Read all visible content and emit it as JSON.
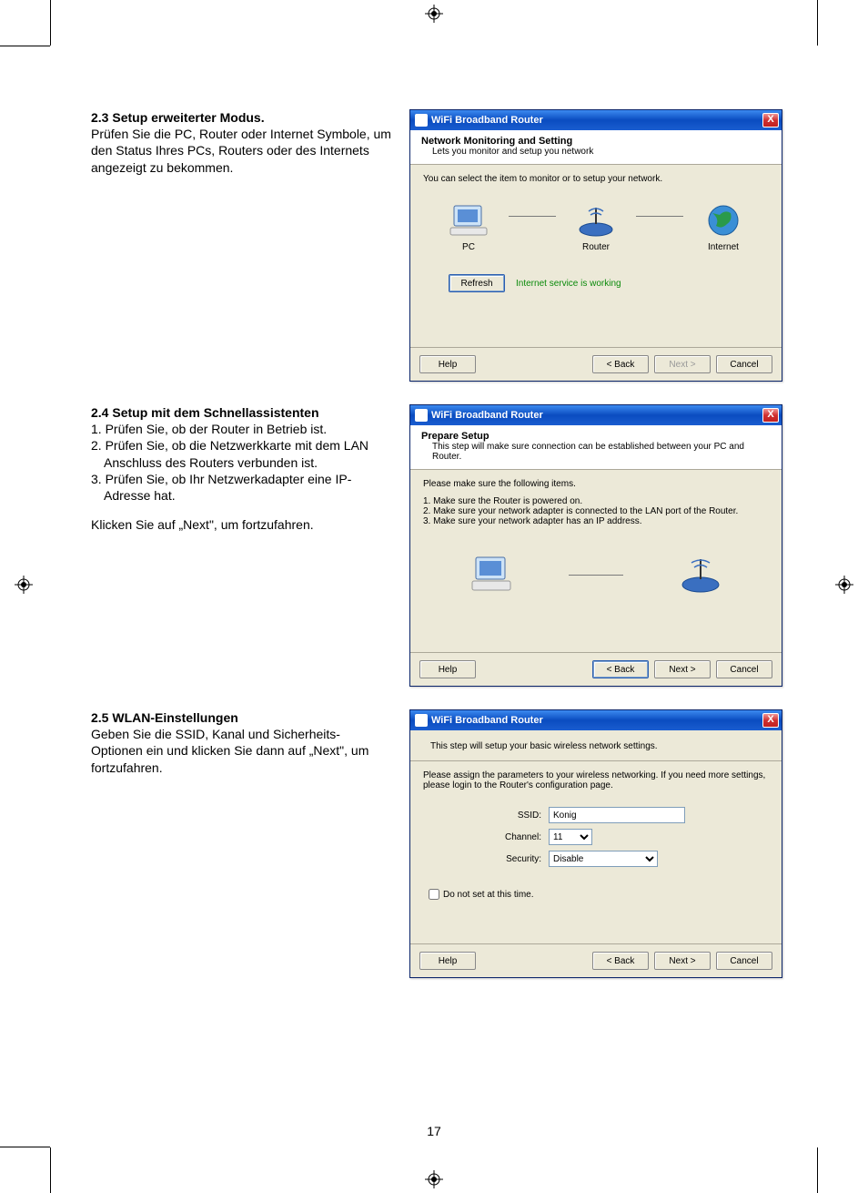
{
  "page_number": "17",
  "section23": {
    "heading": "2.3 Setup erweiterter Modus.",
    "text": "Prüfen Sie die PC, Router oder Internet Symbole, um den Status Ihres PCs, Routers oder des Internets angezeigt zu bekommen."
  },
  "section24": {
    "heading": "2.4 Setup mit dem Schnellassistenten",
    "item1": "1. Prüfen Sie, ob der Router in Betrieb ist.",
    "item2": "2. Prüfen Sie, ob die Netzwerkkarte mit dem LAN Anschluss des Routers verbunden ist.",
    "item3": "3. Prüfen Sie, ob Ihr Netzwerkadapter eine IP-Adresse hat.",
    "footer": "Klicken Sie auf „Next\", um fortzufahren."
  },
  "section25": {
    "heading": "2.5 WLAN-Einstellungen",
    "text": "Geben Sie die SSID, Kanal und Sicherheits-Optionen ein und klicken Sie dann auf „Next\", um fortzufahren."
  },
  "dialog_common": {
    "title": "WiFi Broadband Router",
    "close": "X",
    "help": "Help",
    "back": "< Back",
    "next": "Next >",
    "cancel": "Cancel"
  },
  "dialog1": {
    "header_title": "Network Monitoring and Setting",
    "header_sub": "Lets you monitor and setup you network",
    "instruction": "You can select the item to monitor or to setup your network.",
    "pc_label": "PC",
    "router_label": "Router",
    "internet_label": "Internet",
    "refresh": "Refresh",
    "status": "Internet service is working"
  },
  "dialog2": {
    "header_title": "Prepare Setup",
    "header_sub": "This step will make sure connection can be established between your PC and Router.",
    "intro": "Please make sure the following items.",
    "line1": "1. Make sure the Router is powered on.",
    "line2": "2. Make sure your network adapter is connected to the LAN port of the Router.",
    "line3": "3. Make sure your network adapter has an IP address."
  },
  "dialog3": {
    "header_sub": "This step will setup your basic wireless network settings.",
    "instruction": "Please assign the parameters to your wireless networking. If you need more settings, please login to the Router's configuration page.",
    "ssid_label": "SSID:",
    "ssid_value": "Konig",
    "channel_label": "Channel:",
    "channel_value": "11",
    "security_label": "Security:",
    "security_value": "Disable",
    "checkbox_label": "Do not set at this time."
  }
}
